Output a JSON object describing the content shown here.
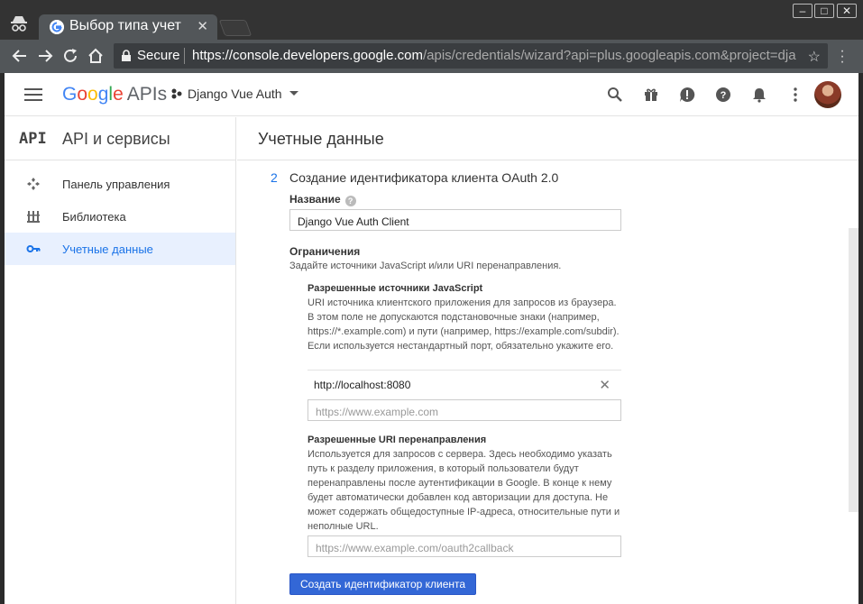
{
  "browser": {
    "tab_title": "Выбор типа учет",
    "secure_label": "Secure",
    "url_host": "https://console.developers.google.com",
    "url_path": "/apis/credentials/wizard?api=plus.googleapis.com&project=djan…",
    "window_controls": [
      "minimize-icon",
      "maximize-icon",
      "close-icon"
    ],
    "nav_icons": [
      "back-icon",
      "forward-icon",
      "reload-icon",
      "home-icon"
    ]
  },
  "appbar": {
    "logo_google": "Google",
    "logo_apis": "APIs",
    "project_name": "Django Vue Auth",
    "icons": [
      "search-icon",
      "gift-icon",
      "alert-icon",
      "help-icon",
      "bell-icon",
      "more-icon"
    ]
  },
  "sidebar": {
    "badge": "API",
    "title": "API и сервисы",
    "items": [
      {
        "label": "Панель управления",
        "icon": "dashboard-icon",
        "active": false
      },
      {
        "label": "Библиотека",
        "icon": "library-icon",
        "active": false
      },
      {
        "label": "Учетные данные",
        "icon": "key-icon",
        "active": true
      }
    ],
    "collapse_label": "<|"
  },
  "content": {
    "page_title": "Учетные данные",
    "step_number": "2",
    "step_title": "Создание идентификатора клиента OAuth 2.0",
    "name_label": "Название",
    "name_help": "?",
    "name_value": "Django Vue Auth Client",
    "restrictions_title": "Ограничения",
    "restrictions_subtitle": "Задайте источники JavaScript и/или URI перенаправления.",
    "js_origins_title": "Разрешенные источники JavaScript",
    "js_origins_desc": "URI источника клиентского приложения для запросов из браузера. В этом поле не допускаются подстановочные знаки (например, https://*.example.com) и пути (например, https://example.com/subdir). Если используется нестандартный порт, обязательно укажите его.",
    "js_origin_value": "http://localhost:8080",
    "js_origin_placeholder": "https://www.example.com",
    "redirect_title": "Разрешенные URI перенаправления",
    "redirect_desc": "Используется для запросов с сервера. Здесь необходимо указать путь к разделу приложения, в который пользователи будут перенаправлены после аутентификации в Google. В конце к нему будет автоматически добавлен код авторизации для доступа. Не может содержать общедоступные IP-адреса, относительные пути и неполные URL.",
    "redirect_placeholder": "https://www.example.com/oauth2callback",
    "create_button": "Создать идентификатор клиента"
  }
}
